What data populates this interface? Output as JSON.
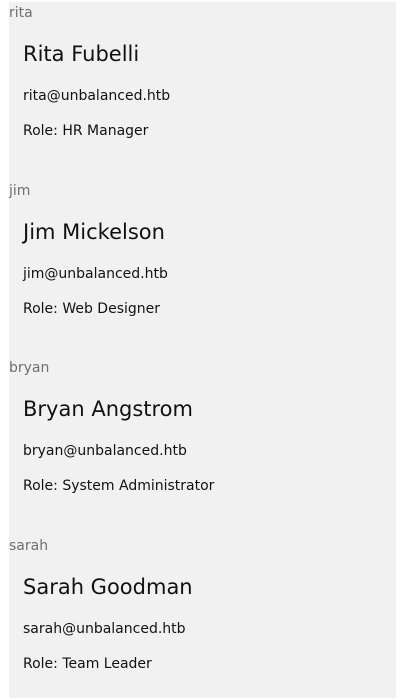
{
  "users": [
    {
      "username": "rita",
      "full_name": "Rita Fubelli",
      "email": "rita@unbalanced.htb",
      "role": "Role: HR Manager"
    },
    {
      "username": "jim",
      "full_name": "Jim Mickelson",
      "email": "jim@unbalanced.htb",
      "role": "Role: Web Designer"
    },
    {
      "username": "bryan",
      "full_name": "Bryan Angstrom",
      "email": "bryan@unbalanced.htb",
      "role": "Role: System Administrator"
    },
    {
      "username": "sarah",
      "full_name": "Sarah Goodman",
      "email": "sarah@unbalanced.htb",
      "role": "Role: Team Leader"
    }
  ]
}
